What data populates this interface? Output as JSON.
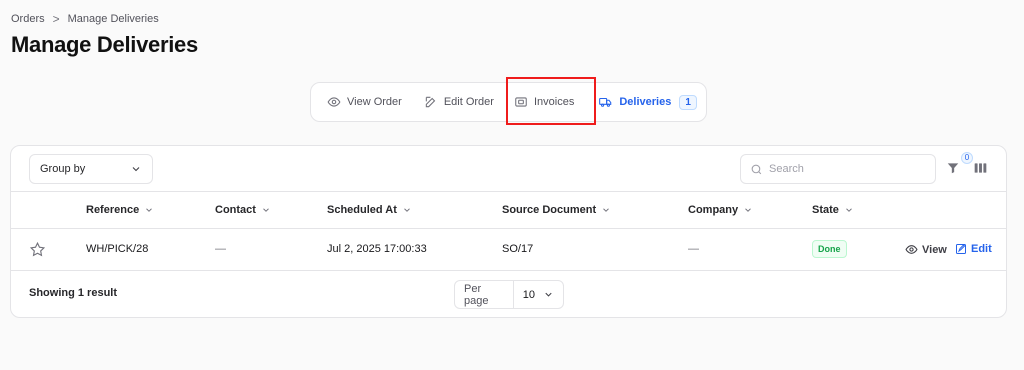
{
  "breadcrumb": {
    "parent": "Orders",
    "separator": ">",
    "current": "Manage Deliveries"
  },
  "page": {
    "title": "Manage Deliveries"
  },
  "tabs": [
    {
      "label": "View Order",
      "icon": "eye-icon"
    },
    {
      "label": "Edit Order",
      "icon": "edit-icon"
    },
    {
      "label": "Invoices",
      "icon": "invoice-icon"
    },
    {
      "label": "Deliveries",
      "icon": "truck-icon",
      "badge": "1",
      "active": true
    }
  ],
  "toolbar": {
    "group_by_label": "Group by",
    "search_placeholder": "Search",
    "filter_count": "0"
  },
  "table": {
    "columns": [
      "Reference",
      "Contact",
      "Scheduled At",
      "Source Document",
      "Company",
      "State"
    ],
    "rows": [
      {
        "reference": "WH/PICK/28",
        "contact": "—",
        "scheduled_at": "Jul 2, 2025 17:00:33",
        "source_document": "SO/17",
        "company": "—",
        "state": "Done",
        "view_label": "View",
        "edit_label": "Edit"
      }
    ]
  },
  "footer": {
    "showing": "Showing 1 result",
    "per_page_label": "Per page",
    "per_page_value": "10"
  },
  "colors": {
    "accent": "#2563eb",
    "success": "#16a34a",
    "highlight": "#ef1c1c"
  }
}
